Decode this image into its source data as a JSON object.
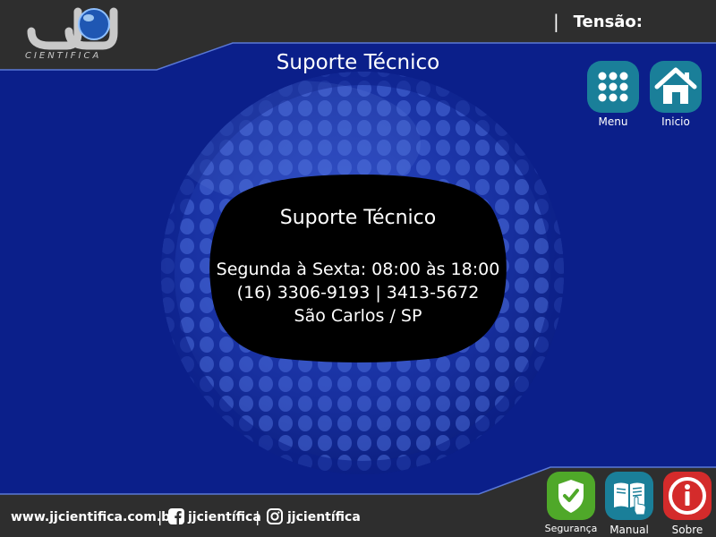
{
  "header": {
    "title": "Suporte Técnico",
    "tension_label": "Tensão:",
    "separator": "|",
    "logo_text": "CIENTIFICA"
  },
  "nav": {
    "menu_label": "Menu",
    "home_label": "Inicio"
  },
  "support_panel": {
    "title": "Suporte Técnico",
    "hours": "Segunda à Sexta: 08:00 às 18:00",
    "phones": "(16) 3306-9193 | 3413-5672",
    "location": "São Carlos / SP"
  },
  "footer": {
    "website": "www.jjcientifica.com.br",
    "facebook": "jjcientífica",
    "instagram": "jjcientífica",
    "separator": "|",
    "buttons": {
      "safety_label": "Segurança",
      "manual_label": "Manual",
      "about_label": "Sobre"
    }
  },
  "colors": {
    "background_blue": "#0b1f8a",
    "frame_gray": "#2e2e2e",
    "teal_button": "#1a7f99",
    "green_button": "#4fa829",
    "red_button": "#d42b2b",
    "panel_black": "#000000"
  }
}
